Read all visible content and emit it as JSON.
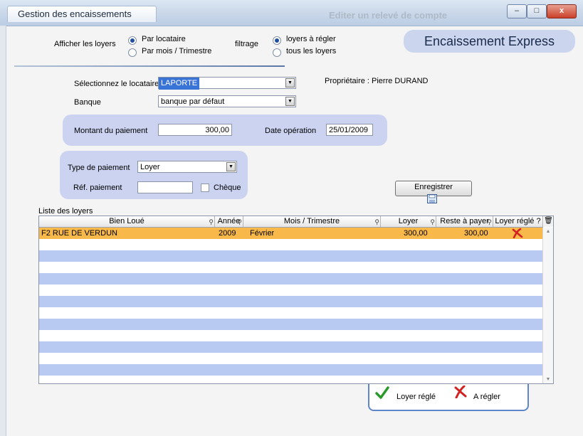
{
  "window": {
    "title_tab": "Gestion des encaissements",
    "secondary_tab": "Editer un relevé de compte",
    "minimize": "–",
    "maximize": "□",
    "close": "x"
  },
  "display": {
    "label": "Afficher les loyers",
    "opt1": "Par locataire",
    "opt2": "Par mois / Trimestre",
    "selected": "Par locataire"
  },
  "filter": {
    "label": "filtrage",
    "opt1": "loyers à régler",
    "opt2": "tous les loyers",
    "selected": "loyers à régler"
  },
  "express_title": "Encaissement Express",
  "form": {
    "tenant_label": "Sélectionnez le locataire",
    "tenant_value": "LAPORTE",
    "owner_text": "Propriétaire : Pierre DURAND",
    "bank_label": "Banque",
    "bank_value": "banque par défaut",
    "amount_label": "Montant du paiement",
    "amount_value": "300,00",
    "date_label": "Date opération",
    "date_value": "25/01/2009",
    "paytype_label": "Type de paiement",
    "paytype_value": "Loyer",
    "ref_label": "Réf. paiement",
    "ref_value": "",
    "cheque_label": "Chèque",
    "save_label": "Enregistrer"
  },
  "list": {
    "title": "Liste des loyers",
    "columns": [
      "Bien Loué",
      "Année",
      "Mois / Trimestre",
      "Loyer",
      "Reste à payer",
      "Loyer réglé ?"
    ],
    "rows": [
      {
        "bien": "F2 RUE DE VERDUN",
        "annee": "2009",
        "mois": "Février",
        "loyer": "300,00",
        "reste": "300,00",
        "regle": "no"
      }
    ]
  },
  "legend": {
    "paid": "Loyer réglé",
    "unpaid": "A régler"
  },
  "colors": {
    "selected_row": "#f8b84a",
    "alt_row": "#b8c9f2",
    "panel": "#cbd3f1",
    "check": "#2a9a2a",
    "cross": "#d42222"
  }
}
